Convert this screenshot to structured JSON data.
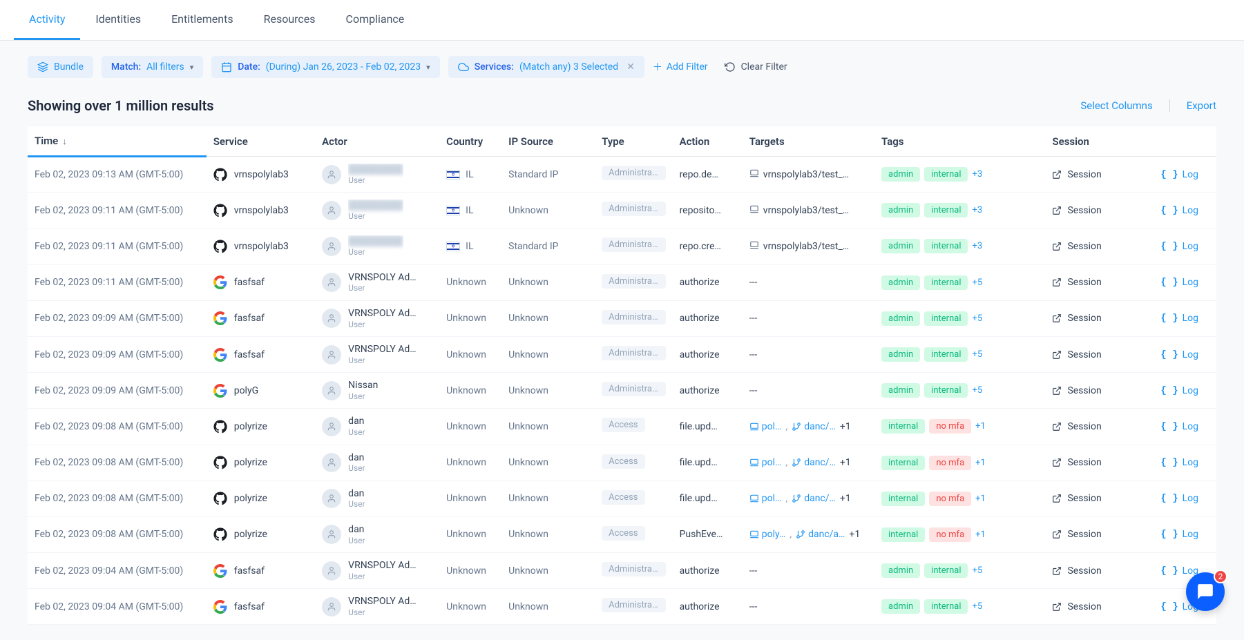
{
  "tabs": [
    "Activity",
    "Identities",
    "Entitlements",
    "Resources",
    "Compliance"
  ],
  "activeTab": 0,
  "filters": {
    "bundle": "Bundle",
    "match_label": "Match:",
    "match_value": "All filters",
    "date_label": "Date:",
    "date_value": "(During) Jan 26, 2023 - Feb 02, 2023",
    "services_label": "Services:",
    "services_value": "(Match any) 3 Selected",
    "add_filter": "Add Filter",
    "clear_filter": "Clear Filter"
  },
  "results_text": "Showing over 1 million results",
  "header_actions": {
    "select_columns": "Select Columns",
    "export": "Export"
  },
  "columns": [
    "Time",
    "Service",
    "Actor",
    "Country",
    "IP Source",
    "Type",
    "Action",
    "Targets",
    "Tags",
    "Session",
    ""
  ],
  "session_label": "Session",
  "log_label": "Log",
  "rows": [
    {
      "time": "Feb 02, 2023 09:13 AM (GMT-5:00)",
      "service": "vrnspolylab3",
      "svc": "github",
      "actor_name": "",
      "actor_role": "User",
      "actor_blur": true,
      "country": "IL",
      "has_flag": true,
      "ip": "Standard IP",
      "type": "Administration",
      "action": "repo.de…",
      "targets": [
        {
          "icon": "laptop",
          "text": "vrnspolylab3/test_…",
          "link": false
        }
      ],
      "targets_more": "",
      "tags": [
        "admin",
        "internal"
      ],
      "tags_more": "+3"
    },
    {
      "time": "Feb 02, 2023 09:11 AM (GMT-5:00)",
      "service": "vrnspolylab3",
      "svc": "github",
      "actor_name": "",
      "actor_role": "User",
      "actor_blur": true,
      "country": "IL",
      "has_flag": true,
      "ip": "Unknown",
      "type": "Administration",
      "action": "reposito…",
      "targets": [
        {
          "icon": "laptop",
          "text": "vrnspolylab3/test_…",
          "link": false
        }
      ],
      "targets_more": "",
      "tags": [
        "admin",
        "internal"
      ],
      "tags_more": "+3"
    },
    {
      "time": "Feb 02, 2023 09:11 AM (GMT-5:00)",
      "service": "vrnspolylab3",
      "svc": "github",
      "actor_name": "",
      "actor_role": "User",
      "actor_blur": true,
      "country": "IL",
      "has_flag": true,
      "ip": "Standard IP",
      "type": "Administration",
      "action": "repo.cre…",
      "targets": [
        {
          "icon": "laptop",
          "text": "vrnspolylab3/test_…",
          "link": false
        }
      ],
      "targets_more": "",
      "tags": [
        "admin",
        "internal"
      ],
      "tags_more": "+3"
    },
    {
      "time": "Feb 02, 2023 09:11 AM (GMT-5:00)",
      "service": "fasfsaf",
      "svc": "google",
      "actor_name": "VRNSPOLY Ad…",
      "actor_role": "User",
      "actor_blur": false,
      "country": "Unknown",
      "has_flag": false,
      "ip": "Unknown",
      "type": "Administration",
      "action": "authorize",
      "targets": [
        {
          "icon": "",
          "text": "---",
          "link": false
        }
      ],
      "targets_more": "",
      "tags": [
        "admin",
        "internal"
      ],
      "tags_more": "+5"
    },
    {
      "time": "Feb 02, 2023 09:09 AM (GMT-5:00)",
      "service": "fasfsaf",
      "svc": "google",
      "actor_name": "VRNSPOLY Ad…",
      "actor_role": "User",
      "actor_blur": false,
      "country": "Unknown",
      "has_flag": false,
      "ip": "Unknown",
      "type": "Administration",
      "action": "authorize",
      "targets": [
        {
          "icon": "",
          "text": "---",
          "link": false
        }
      ],
      "targets_more": "",
      "tags": [
        "admin",
        "internal"
      ],
      "tags_more": "+5"
    },
    {
      "time": "Feb 02, 2023 09:09 AM (GMT-5:00)",
      "service": "fasfsaf",
      "svc": "google",
      "actor_name": "VRNSPOLY Ad…",
      "actor_role": "User",
      "actor_blur": false,
      "country": "Unknown",
      "has_flag": false,
      "ip": "Unknown",
      "type": "Administration",
      "action": "authorize",
      "targets": [
        {
          "icon": "",
          "text": "---",
          "link": false
        }
      ],
      "targets_more": "",
      "tags": [
        "admin",
        "internal"
      ],
      "tags_more": "+5"
    },
    {
      "time": "Feb 02, 2023 09:09 AM (GMT-5:00)",
      "service": "polyG",
      "svc": "google",
      "actor_name": "Nissan",
      "actor_role": "User",
      "actor_blur": false,
      "country": "Unknown",
      "has_flag": false,
      "ip": "Unknown",
      "type": "Administration",
      "action": "authorize",
      "targets": [
        {
          "icon": "",
          "text": "---",
          "link": false
        }
      ],
      "targets_more": "",
      "tags": [
        "admin",
        "internal"
      ],
      "tags_more": "+5"
    },
    {
      "time": "Feb 02, 2023 09:08 AM (GMT-5:00)",
      "service": "polyrize",
      "svc": "github",
      "actor_name": "dan",
      "actor_role": "User",
      "actor_blur": false,
      "country": "Unknown",
      "has_flag": false,
      "ip": "Unknown",
      "type": "Access",
      "action": "file.upd…",
      "targets": [
        {
          "icon": "laptop",
          "text": "pol…",
          "link": true
        },
        {
          "icon": "branch",
          "text": "danc/…",
          "link": true
        }
      ],
      "targets_more": "+1",
      "tags": [
        "internal",
        "nomfa"
      ],
      "tags_more": "+1"
    },
    {
      "time": "Feb 02, 2023 09:08 AM (GMT-5:00)",
      "service": "polyrize",
      "svc": "github",
      "actor_name": "dan",
      "actor_role": "User",
      "actor_blur": false,
      "country": "Unknown",
      "has_flag": false,
      "ip": "Unknown",
      "type": "Access",
      "action": "file.upd…",
      "targets": [
        {
          "icon": "laptop",
          "text": "pol…",
          "link": true
        },
        {
          "icon": "branch",
          "text": "danc/…",
          "link": true
        }
      ],
      "targets_more": "+1",
      "tags": [
        "internal",
        "nomfa"
      ],
      "tags_more": "+1"
    },
    {
      "time": "Feb 02, 2023 09:08 AM (GMT-5:00)",
      "service": "polyrize",
      "svc": "github",
      "actor_name": "dan",
      "actor_role": "User",
      "actor_blur": false,
      "country": "Unknown",
      "has_flag": false,
      "ip": "Unknown",
      "type": "Access",
      "action": "file.upd…",
      "targets": [
        {
          "icon": "laptop",
          "text": "pol…",
          "link": true
        },
        {
          "icon": "branch",
          "text": "danc/…",
          "link": true
        }
      ],
      "targets_more": "+1",
      "tags": [
        "internal",
        "nomfa"
      ],
      "tags_more": "+1"
    },
    {
      "time": "Feb 02, 2023 09:08 AM (GMT-5:00)",
      "service": "polyrize",
      "svc": "github",
      "actor_name": "dan",
      "actor_role": "User",
      "actor_blur": false,
      "country": "Unknown",
      "has_flag": false,
      "ip": "Unknown",
      "type": "Access",
      "action": "PushEve…",
      "targets": [
        {
          "icon": "laptop",
          "text": "poly…",
          "link": true
        },
        {
          "icon": "branch",
          "text": "danc/a…",
          "link": true
        }
      ],
      "targets_more": "+1",
      "tags": [
        "internal",
        "nomfa"
      ],
      "tags_more": "+1"
    },
    {
      "time": "Feb 02, 2023 09:04 AM (GMT-5:00)",
      "service": "fasfsaf",
      "svc": "google",
      "actor_name": "VRNSPOLY Ad…",
      "actor_role": "User",
      "actor_blur": false,
      "country": "Unknown",
      "has_flag": false,
      "ip": "Unknown",
      "type": "Administration",
      "action": "authorize",
      "targets": [
        {
          "icon": "",
          "text": "---",
          "link": false
        }
      ],
      "targets_more": "",
      "tags": [
        "admin",
        "internal"
      ],
      "tags_more": "+5"
    },
    {
      "time": "Feb 02, 2023 09:04 AM (GMT-5:00)",
      "service": "fasfsaf",
      "svc": "google",
      "actor_name": "VRNSPOLY Ad…",
      "actor_role": "User",
      "actor_blur": false,
      "country": "Unknown",
      "has_flag": false,
      "ip": "Unknown",
      "type": "Administration",
      "action": "authorize",
      "targets": [
        {
          "icon": "",
          "text": "---",
          "link": false
        }
      ],
      "targets_more": "",
      "tags": [
        "admin",
        "internal"
      ],
      "tags_more": "+5"
    }
  ],
  "tag_labels": {
    "admin": "admin",
    "internal": "internal",
    "nomfa": "no mfa"
  },
  "chat_badge": "2"
}
